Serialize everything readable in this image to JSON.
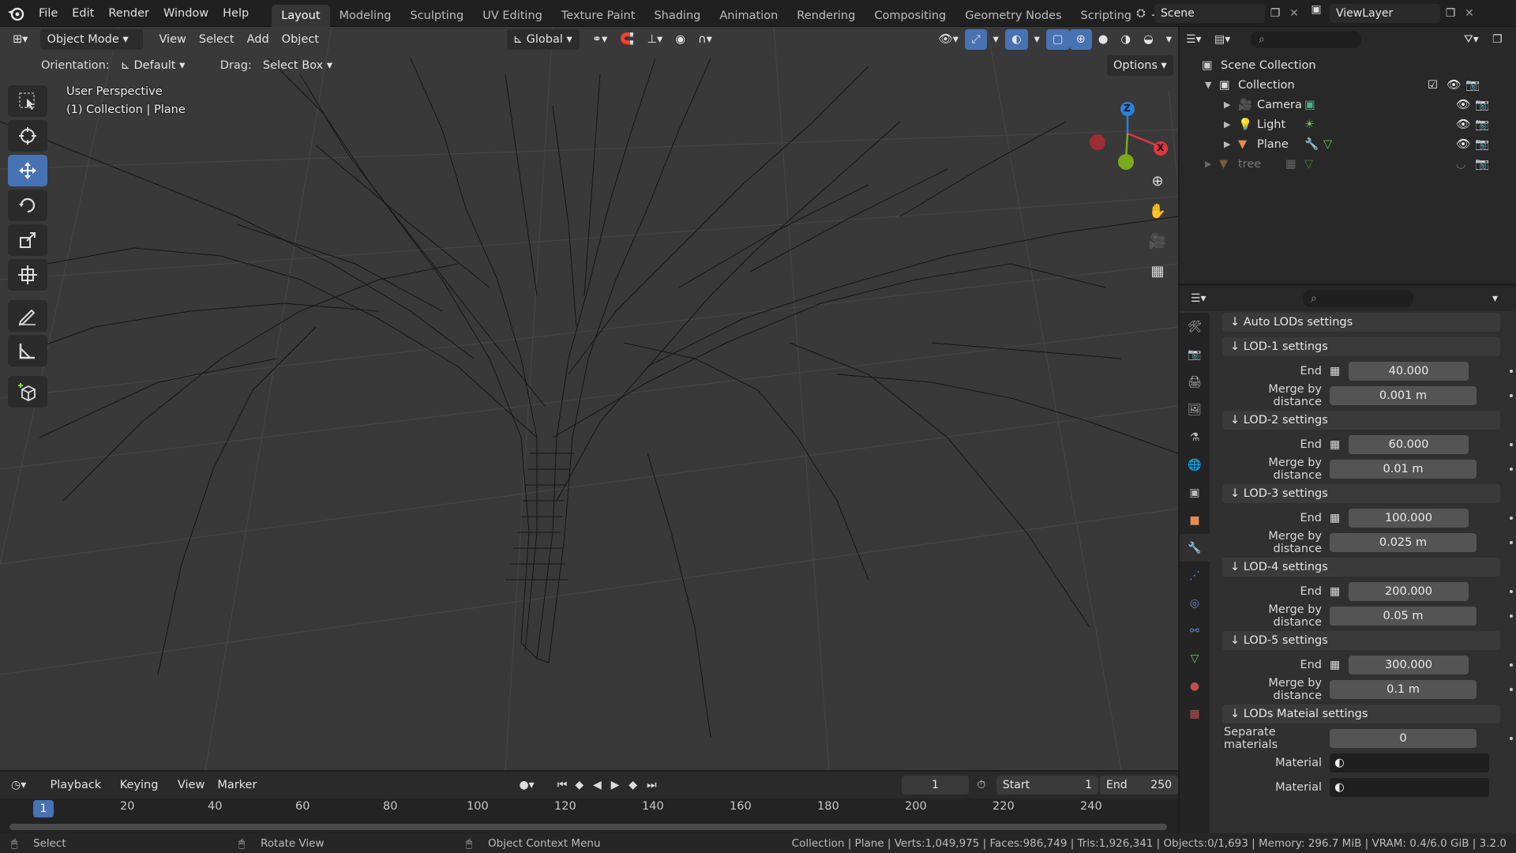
{
  "topbar": {
    "menus": [
      "File",
      "Edit",
      "Render",
      "Window",
      "Help"
    ],
    "workspaces": [
      "Layout",
      "Modeling",
      "Sculpting",
      "UV Editing",
      "Texture Paint",
      "Shading",
      "Animation",
      "Rendering",
      "Compositing",
      "Geometry Nodes",
      "Scripting"
    ],
    "active_workspace": "Layout",
    "add_tab": "+",
    "scene": "Scene",
    "view_layer": "ViewLayer"
  },
  "viewport_header": {
    "mode": "Object Mode",
    "menus": [
      "View",
      "Select",
      "Add",
      "Object"
    ],
    "orientation_global": "Global",
    "orientation_label": "Orientation:",
    "orientation_value": "Default",
    "drag_label": "Drag:",
    "drag_value": "Select Box",
    "options": "Options"
  },
  "viewport": {
    "perspective": "User Perspective",
    "collection_info": "(1) Collection | Plane",
    "gizmo": {
      "z": "Z",
      "x": "X"
    },
    "colors": {
      "bg": "#393939",
      "wire": "#111111",
      "grid": "#444444"
    }
  },
  "outliner": {
    "root": "Scene Collection",
    "collection": "Collection",
    "items": [
      {
        "name": "Camera",
        "icon": "camera-icon"
      },
      {
        "name": "Light",
        "icon": "light-icon"
      },
      {
        "name": "Plane",
        "icon": "mesh-icon"
      },
      {
        "name": "tree",
        "icon": "mesh-icon"
      }
    ]
  },
  "properties": {
    "sections": [
      {
        "title": "↓ Auto LODs settings"
      },
      {
        "title": "↓ LOD-1 settings",
        "end": "40.000",
        "merge": "0.001 m"
      },
      {
        "title": "↓ LOD-2 settings",
        "end": "60.000",
        "merge": "0.01 m"
      },
      {
        "title": "↓ LOD-3 settings",
        "end": "100.000",
        "merge": "0.025 m"
      },
      {
        "title": "↓ LOD-4 settings",
        "end": "200.000",
        "merge": "0.05 m"
      },
      {
        "title": "↓ LOD-5 settings",
        "end": "300.000",
        "merge": "0.1 m"
      },
      {
        "title": "↓ LODs Mateial settings"
      }
    ],
    "end_label": "End",
    "merge_label": "Merge by distance",
    "separate_materials_label": "Separate materials",
    "separate_materials_value": "0",
    "material_label": "Material"
  },
  "timeline": {
    "menus": [
      "Playback",
      "Keying",
      "View",
      "Marker"
    ],
    "current_frame": "1",
    "start_label": "Start",
    "start_value": "1",
    "end_label": "End",
    "end_value": "250",
    "ticks": [
      "20",
      "40",
      "60",
      "80",
      "100",
      "120",
      "140",
      "160",
      "180",
      "200",
      "220",
      "240"
    ],
    "playhead": "1"
  },
  "statusbar": {
    "select": "Select",
    "rotate": "Rotate View",
    "context": "Object Context Menu",
    "stats": "Collection | Plane | Verts:1,049,975 | Faces:986,749 | Tris:1,926,341 | Objects:0/1,693 | Memory: 296.7 MiB | VRAM: 0.4/6.0 GiB | 3.2.0"
  }
}
